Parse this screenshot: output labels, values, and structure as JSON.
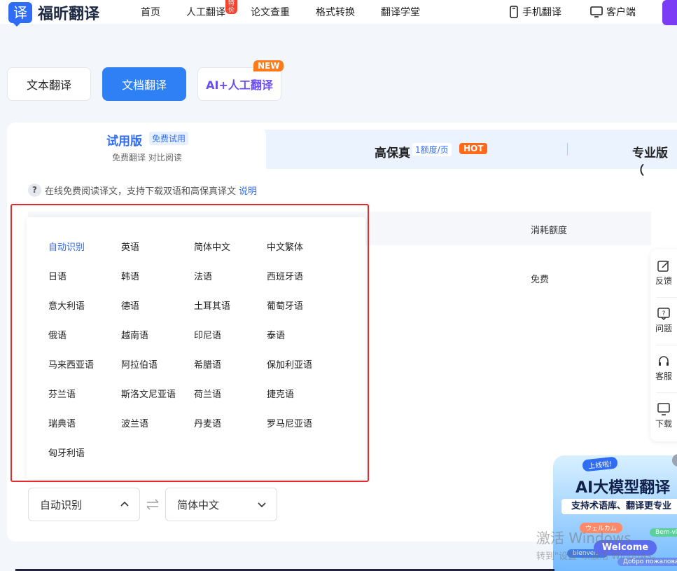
{
  "header": {
    "logo_glyph": "译",
    "logo_text": "福昕翻译",
    "nav": [
      "首页",
      "人工翻译",
      "论文查重",
      "格式转换",
      "翻译学堂"
    ],
    "nav_badge": "特价",
    "mobile": "手机翻译",
    "client": "客户端"
  },
  "modes": {
    "text": "文本翻译",
    "document": "文档翻译",
    "ai_human": "AI+人工翻译",
    "new_badge": "NEW"
  },
  "plans": {
    "trial_title": "试用版",
    "trial_tag": "免费试用",
    "trial_sub": "免费翻译 对比阅读",
    "hifi_title": "高保真",
    "hifi_tag": "1额度/页",
    "hot": "HOT",
    "pro_title": "专业版（"
  },
  "info": {
    "text": "在线免费阅读译文，支持下载双语和高保真译文",
    "link": "说明"
  },
  "table": {
    "cost_header": "消耗额度",
    "cost_value": "免费"
  },
  "languages": [
    "自动识别",
    "英语",
    "简体中文",
    "中文繁体",
    "日语",
    "韩语",
    "法语",
    "西班牙语",
    "意大利语",
    "德语",
    "土耳其语",
    "葡萄牙语",
    "俄语",
    "越南语",
    "印尼语",
    "泰语",
    "马来西亚语",
    "阿拉伯语",
    "希腊语",
    "保加利亚语",
    "芬兰语",
    "斯洛文尼亚语",
    "荷兰语",
    "捷克语",
    "瑞典语",
    "波兰语",
    "丹麦语",
    "罗马尼亚语",
    "匈牙利语"
  ],
  "selectors": {
    "source": "自动识别",
    "target": "简体中文"
  },
  "side_rail": [
    "反馈",
    "问题",
    "客服",
    "下载"
  ],
  "promo": {
    "tag": "上线啦!",
    "title": "AI大模型翻译",
    "subtitle": "支持术语库、翻译更专业",
    "bubble_ja": "ウェルカム",
    "bubble_pt": "Bem-vindo",
    "bubble_fr": "bienvenu",
    "bubble_ru": "Добро пожаловать",
    "welcome": "Welcome"
  },
  "watermark": {
    "line1": "激活 Windows",
    "line2": "转到\"设置\"以激活 Windows。"
  },
  "colors": {
    "accent": "#2f80f5",
    "highlight_box": "#e42a2a",
    "hot": "#ff6a1a"
  }
}
